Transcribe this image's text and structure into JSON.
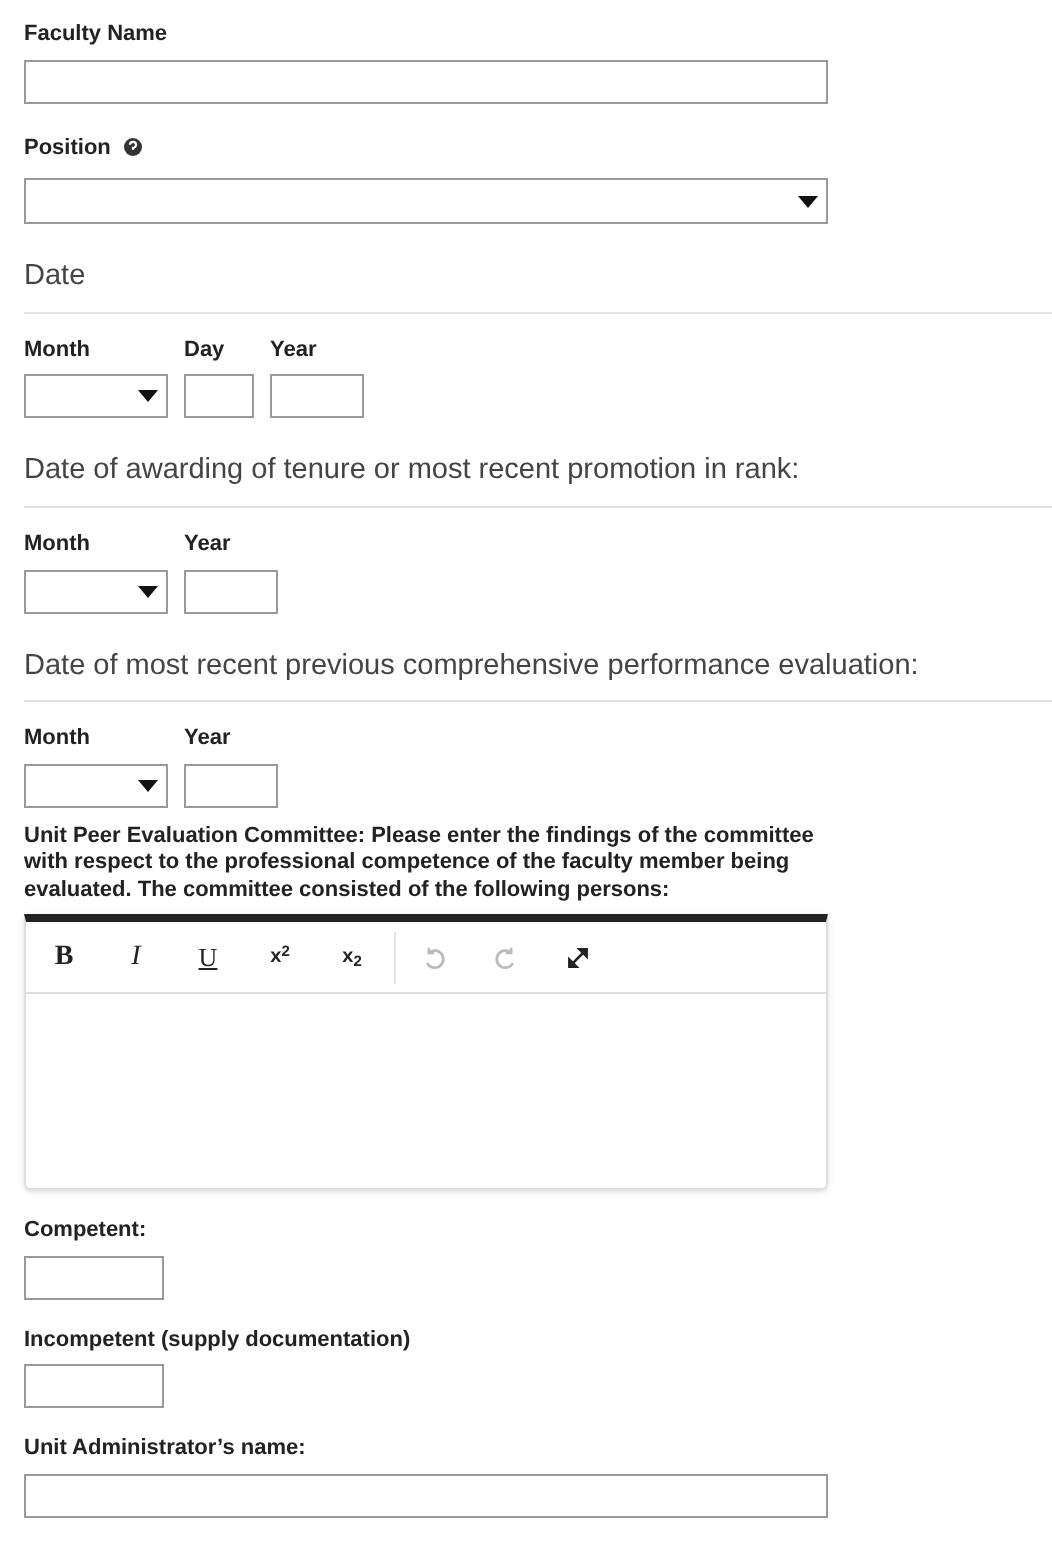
{
  "items": [
    {
      "kind": "text",
      "label": "Faculty Name"
    },
    {
      "kind": "select",
      "label": "Position"
    },
    {
      "kind": "heading",
      "title": "Date"
    },
    {
      "kind": "date",
      "parts": [
        {
          "label": "Month",
          "kind": "select"
        },
        {
          "label": "Day",
          "kind": "input"
        },
        {
          "label": "Year",
          "kind": "input"
        }
      ]
    },
    {
      "kind": "heading",
      "title": "Date of awarding of tenure or most recent promotion in rank:"
    },
    {
      "kind": "date",
      "parts": [
        {
          "label": "Month",
          "kind": "select"
        },
        {
          "label": "Year",
          "kind": "input"
        }
      ]
    },
    {
      "kind": "heading",
      "title": "Date of most recent previous comprehensive performance evaluation:"
    },
    {
      "kind": "date",
      "parts": [
        {
          "label": "Month",
          "kind": "select"
        },
        {
          "label": "Year",
          "kind": "input"
        }
      ]
    },
    {
      "kind": "editor",
      "label": "Unit Peer Evaluation Committee: Please enter the findings of the committee with respect to the professional competence of the faculty member being evaluated. The committee consisted of the following persons:",
      "toolbar": [
        {
          "kind": "text",
          "label": "B"
        },
        {
          "kind": "text",
          "label": "I"
        },
        {
          "kind": "text",
          "label": "U"
        },
        {
          "kind": "text",
          "label": "x$^{2}$"
        },
        {
          "kind": "text",
          "label": "x$_{2}$"
        },
        {
          "kind": "undo",
          "disabled": true
        },
        {
          "kind": "redo",
          "disabled": true
        },
        {
          "kind": "expand",
          "disabled": false
        }
      ]
    },
    {
      "kind": "short_text",
      "label": "Competent:"
    },
    {
      "kind": "short_text",
      "label": "Incompetent (supply documentation)"
    },
    {
      "kind": "text",
      "label": "Unit Administrator’s name:"
    }
  ]
}
